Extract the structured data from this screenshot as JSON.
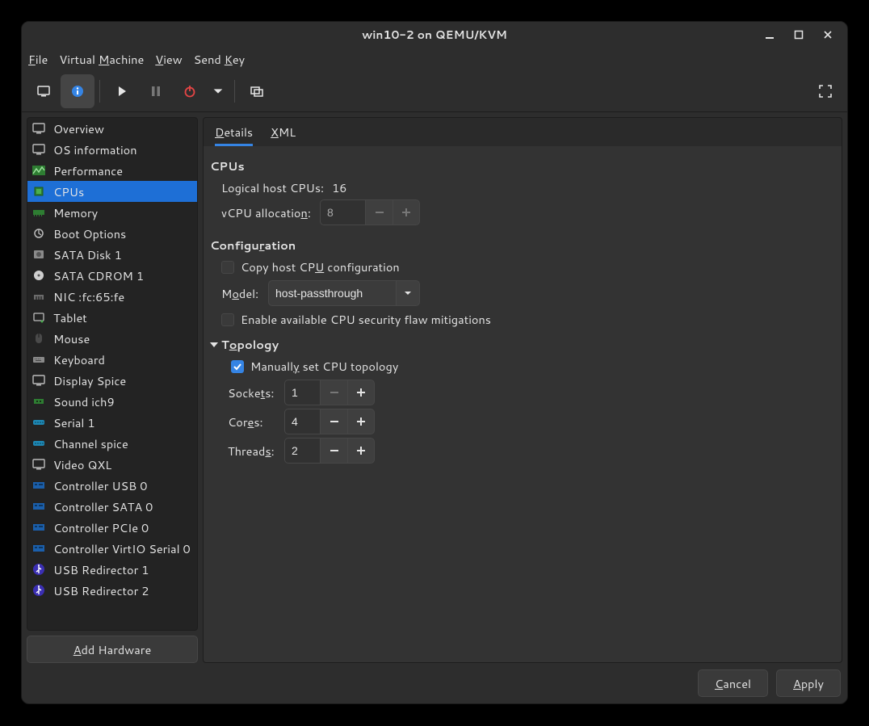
{
  "window": {
    "title": "win10-2 on QEMU/KVM"
  },
  "menus": {
    "file": "File",
    "vm": "Virtual Machine",
    "view": "View",
    "sendkey": "Send Key"
  },
  "sidebar": {
    "items": [
      {
        "label": "Overview"
      },
      {
        "label": "OS information"
      },
      {
        "label": "Performance"
      },
      {
        "label": "CPUs"
      },
      {
        "label": "Memory"
      },
      {
        "label": "Boot Options"
      },
      {
        "label": "SATA Disk 1"
      },
      {
        "label": "SATA CDROM 1"
      },
      {
        "label": "NIC :fc:65:fe"
      },
      {
        "label": "Tablet"
      },
      {
        "label": "Mouse"
      },
      {
        "label": "Keyboard"
      },
      {
        "label": "Display Spice"
      },
      {
        "label": "Sound ich9"
      },
      {
        "label": "Serial 1"
      },
      {
        "label": "Channel spice"
      },
      {
        "label": "Video QXL"
      },
      {
        "label": "Controller USB 0"
      },
      {
        "label": "Controller SATA 0"
      },
      {
        "label": "Controller PCIe 0"
      },
      {
        "label": "Controller VirtIO Serial 0"
      },
      {
        "label": "USB Redirector 1"
      },
      {
        "label": "USB Redirector 2"
      }
    ],
    "selected_index": 3,
    "add_hw": "Add Hardware"
  },
  "tabs": {
    "details": "Details",
    "xml": "XML",
    "active": "details"
  },
  "cpus": {
    "title": "CPUs",
    "logical_label": "Logical host CPUs:",
    "logical_value": "16",
    "vcpu_label": "vCPU allocation:",
    "vcpu_value": "8",
    "config_title": "Configuration",
    "copy_host": "Copy host CPU configuration",
    "model_label": "Model:",
    "model_value": "host-passthrough",
    "mitigations": "Enable available CPU security flaw mitigations",
    "topology_title": "Topology",
    "manual_topo": "Manually set CPU topology",
    "sockets_label": "Sockets:",
    "sockets_value": "1",
    "cores_label": "Cores:",
    "cores_value": "4",
    "threads_label": "Threads:",
    "threads_value": "2"
  },
  "footer": {
    "cancel": "Cancel",
    "apply": "Apply"
  }
}
